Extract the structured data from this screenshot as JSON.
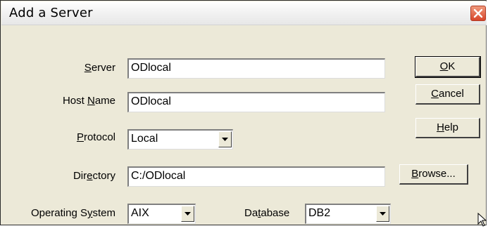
{
  "window": {
    "title": "Add a Server"
  },
  "form": {
    "server": {
      "label_pre": "",
      "label_key": "S",
      "label_post": "erver",
      "value": "ODlocal"
    },
    "host": {
      "label_pre": "Host ",
      "label_key": "N",
      "label_post": "ame",
      "value": "ODlocal"
    },
    "protocol": {
      "label_pre": "",
      "label_key": "P",
      "label_post": "rotocol",
      "value": "Local"
    },
    "directory": {
      "label_pre": "Dir",
      "label_key": "e",
      "label_post": "ctory",
      "value": "C:/ODlocal"
    },
    "os": {
      "label_pre": "Operating S",
      "label_key": "y",
      "label_post": "stem",
      "value": "AIX"
    },
    "database": {
      "label_pre": "Da",
      "label_key": "t",
      "label_post": "abase",
      "value": "DB2"
    }
  },
  "buttons": {
    "ok": {
      "pre": "",
      "key": "O",
      "post": "K"
    },
    "cancel": {
      "pre": "",
      "key": "C",
      "post": "ancel"
    },
    "help": {
      "pre": "",
      "key": "H",
      "post": "elp"
    },
    "browse": {
      "pre": "",
      "key": "B",
      "post": "rowse..."
    }
  },
  "icons": {
    "close": "close-icon",
    "dropdown": "triangle-down-icon",
    "cursor": "mouse-pointer-icon"
  },
  "colors": {
    "dialog_bg": "#ece9d8",
    "close_button": "#d8452a"
  }
}
